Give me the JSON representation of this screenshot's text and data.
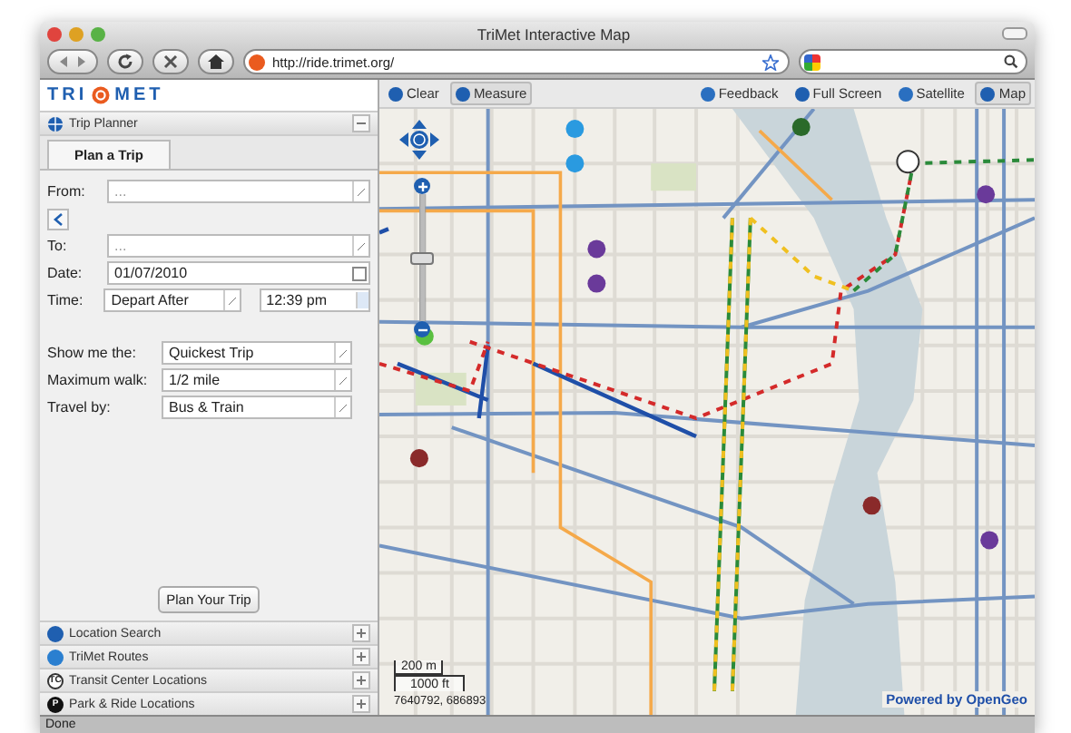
{
  "window": {
    "title": "TriMet Interactive Map"
  },
  "browser": {
    "url": "http://ride.trimet.org/"
  },
  "logo": {
    "left": "TRI",
    "right": "MET"
  },
  "trip_planner": {
    "title": "Trip Planner",
    "expanded": true,
    "tabs": [
      {
        "label": "Plan a Trip",
        "selected": true
      }
    ],
    "from": {
      "label": "From:",
      "value": "..."
    },
    "to": {
      "label": "To:",
      "value": "..."
    },
    "date": {
      "label": "Date:",
      "value": "01/07/2010"
    },
    "time": {
      "label": "Time:",
      "mode": "Depart After",
      "value": "12:39 pm"
    },
    "options": [
      {
        "label": "Show me the:",
        "value": "Quickest Trip"
      },
      {
        "label": "Maximum walk:",
        "value": "1/2 mile"
      },
      {
        "label": "Travel by:",
        "value": "Bus & Train"
      }
    ],
    "submit": "Plan Your Trip"
  },
  "sections": [
    {
      "kind": "search",
      "title": "Location Search",
      "expanded": false
    },
    {
      "kind": "routes",
      "title": "TriMet Routes",
      "expanded": false
    },
    {
      "kind": "transit",
      "badge": "TC",
      "title": "Transit Center Locations",
      "expanded": false
    },
    {
      "kind": "parking",
      "badge": "P",
      "title": "Park & Ride Locations",
      "expanded": false
    }
  ],
  "map_toolbar": {
    "tools": [
      {
        "label": "Clear",
        "active": false
      },
      {
        "label": "Measure",
        "active": true
      }
    ],
    "views": [
      {
        "kind": "feedback",
        "label": "Feedback",
        "selected": false
      },
      {
        "kind": "fullscreen",
        "label": "Full Screen",
        "selected": false
      },
      {
        "kind": "satellite",
        "label": "Satellite",
        "selected": false
      },
      {
        "kind": "map",
        "label": "Map",
        "selected": true
      }
    ]
  },
  "zoom": {
    "level": 0.45
  },
  "scale": {
    "metric": "200 m",
    "imperial": "1000 ft"
  },
  "coordinates": "7640792, 686893",
  "attribution": "Powered by OpenGeo",
  "status_bar": "Done"
}
